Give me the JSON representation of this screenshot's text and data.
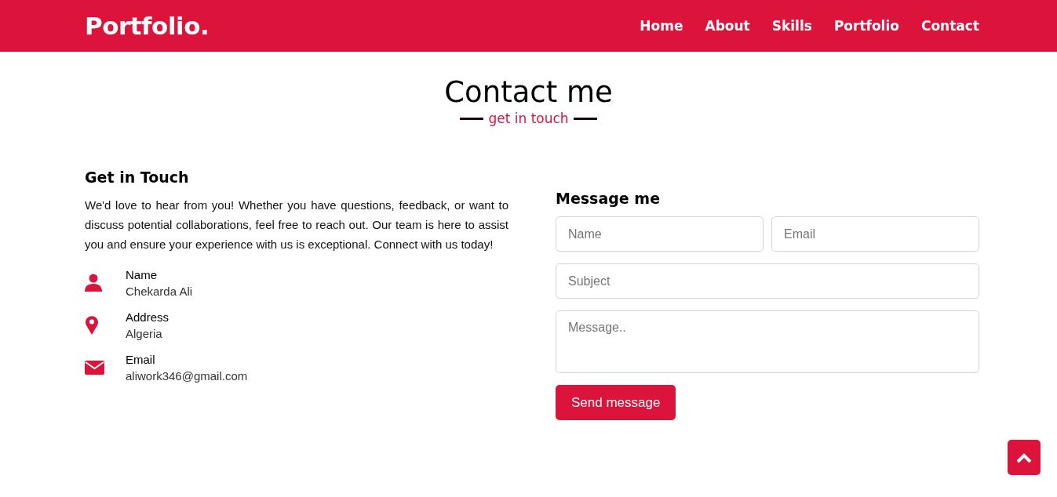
{
  "navbar": {
    "brand": "Portfolio.",
    "links": [
      {
        "label": "Home"
      },
      {
        "label": "About"
      },
      {
        "label": "Skills"
      },
      {
        "label": "Portfolio"
      },
      {
        "label": "Contact"
      }
    ]
  },
  "heading": {
    "title": "Contact me",
    "subtitle": "get in touch"
  },
  "info": {
    "title": "Get in Touch",
    "text": "We'd love to hear from you! Whether you have questions, feedback, or want to discuss potential collaborations, feel free to reach out. Our team is here to assist you and ensure your experience with us is exceptional. Connect with us today!",
    "items": [
      {
        "kind": "person",
        "label": "Name",
        "value": "Chekarda Ali"
      },
      {
        "kind": "location",
        "label": "Address",
        "value": "Algeria"
      },
      {
        "kind": "mail",
        "label": "Email",
        "value": "aliwork346@gmail.com"
      }
    ]
  },
  "form": {
    "title": "Message me",
    "name": {
      "placeholder": "Name"
    },
    "email": {
      "placeholder": "Email"
    },
    "subject": {
      "placeholder": "Subject"
    },
    "message": {
      "placeholder": "Message.."
    },
    "submit": "Send message"
  }
}
